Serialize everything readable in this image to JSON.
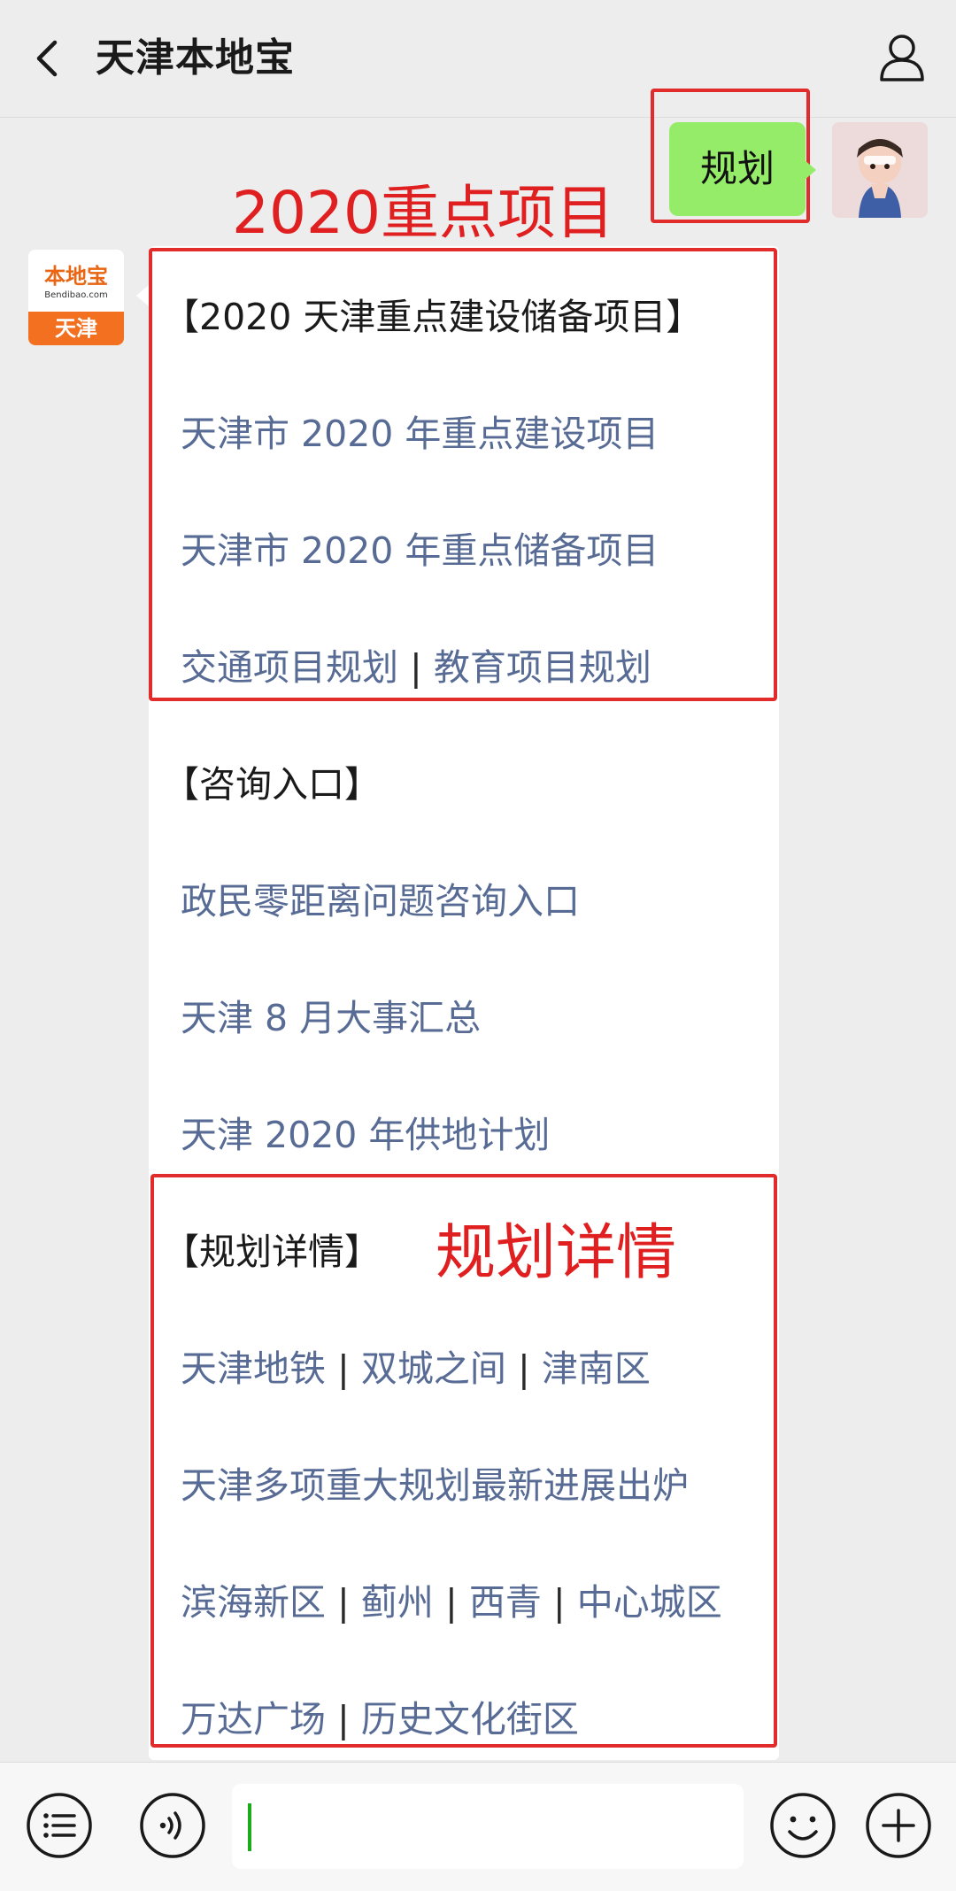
{
  "header": {
    "title": "天津本地宝"
  },
  "user_message": {
    "text": "规划"
  },
  "bot": {
    "avatar_brand": "本地宝",
    "avatar_url": "Bendibao.com",
    "avatar_city": "天津"
  },
  "annotations": {
    "top_label": "2020重点项目",
    "mid_label": "规划详情"
  },
  "card": {
    "lines": [
      {
        "kind": "heading",
        "text": "【2020 天津重点建设储备项目】"
      },
      {
        "kind": "link",
        "text": "天津市 2020 年重点建设项目"
      },
      {
        "kind": "link",
        "text": "天津市 2020 年重点储备项目"
      },
      {
        "kind": "links",
        "parts": [
          "交通项目规划",
          "教育项目规划"
        ]
      },
      {
        "kind": "heading",
        "text": "【咨询入口】"
      },
      {
        "kind": "link",
        "text": "政民零距离问题咨询入口"
      },
      {
        "kind": "link",
        "text": "天津 8 月大事汇总"
      },
      {
        "kind": "link",
        "text": "天津 2020 年供地计划"
      },
      {
        "kind": "heading",
        "text": "【规划详情】"
      },
      {
        "kind": "links",
        "parts": [
          "天津地铁",
          "双城之间",
          "津南区"
        ]
      },
      {
        "kind": "link",
        "text": "天津多项重大规划最新进展出炉"
      },
      {
        "kind": "links",
        "parts": [
          "滨海新区",
          "蓟州",
          "西青",
          "中心城区"
        ]
      },
      {
        "kind": "links",
        "parts": [
          "万达广场",
          "历史文化街区"
        ]
      }
    ],
    "separator": "|"
  },
  "colors": {
    "link": "#576b95",
    "annotation_red": "#e22b2b",
    "bubble_green": "#95ec69",
    "background": "#ededed"
  },
  "icons": {
    "back": "chevron-left-icon",
    "profile": "person-icon",
    "menu": "list-icon",
    "voice": "voice-icon",
    "emoji": "smile-icon",
    "add": "plus-circle-icon"
  }
}
